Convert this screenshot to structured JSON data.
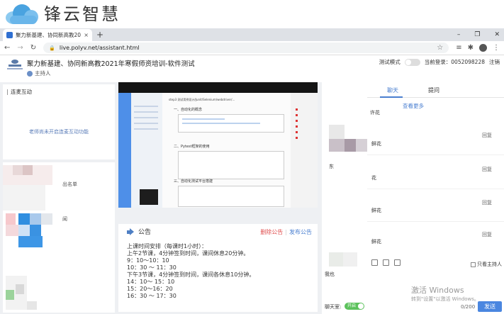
{
  "brand": {
    "name": "锋云智慧"
  },
  "browser": {
    "tab_title": "聚力新基建、协同新高教2021",
    "tab_close": "×",
    "new_tab": "+",
    "win_min": "–",
    "win_max": "❐",
    "win_close": "✕",
    "url": "live.polyv.net/assistant.html"
  },
  "header": {
    "channel_title": "聚力新基建、协同新高教2021年寒假师资培训-软件测试",
    "host_label": "主持人",
    "test_mode_label": "测试模式",
    "login_label": "当前登录：0052098228",
    "logout_label": "注销"
  },
  "mic_panel": {
    "title": "连麦互动",
    "message": "老师尚未开启连麦互动功能"
  },
  "member_panel": {
    "label1": "出名单",
    "label2": "闻"
  },
  "notice": {
    "title": "公告",
    "delete_label": "删除公告",
    "publish_label": "发布公告",
    "lines": [
      "上课时间安排（每课时1小时）：",
      "上午2节课，4分钟签到时间，课间休息20分钟。",
      "9：10～10：10",
      "10：30 ～ 11：30",
      "下午3节课，4分钟签到时间，课间各休息10分钟。",
      "14：10～ 15：10",
      "15：20～16：20",
      "16：30 ～ 17：30"
    ]
  },
  "slide": {
    "heading": "step3  测试用例设计/Junit/Selenium/webdriver/...",
    "section1": "一、自动化的概念",
    "section2": "二、Pytest框架的使用",
    "section3": "三、自动化测试平台搭建"
  },
  "chat": {
    "tab_chat": "聊天",
    "tab_question": "提问",
    "more_link": "查看更多",
    "text_flower1": "许花",
    "text_flower2": "鲜花",
    "text_flower3": "花",
    "text_flower4": "鲜花",
    "text_flower5": "鲜花",
    "text_side1": "东",
    "text_side2": "我也",
    "reply": "回复",
    "host_only": "只看主持人",
    "mute_label": "聊天室:",
    "mute_state": "开启",
    "counter": "0/200",
    "send": "发送",
    "watermark_title": "激活 Windows",
    "watermark_sub": "转到\"设置\"以激活 Windows。"
  }
}
